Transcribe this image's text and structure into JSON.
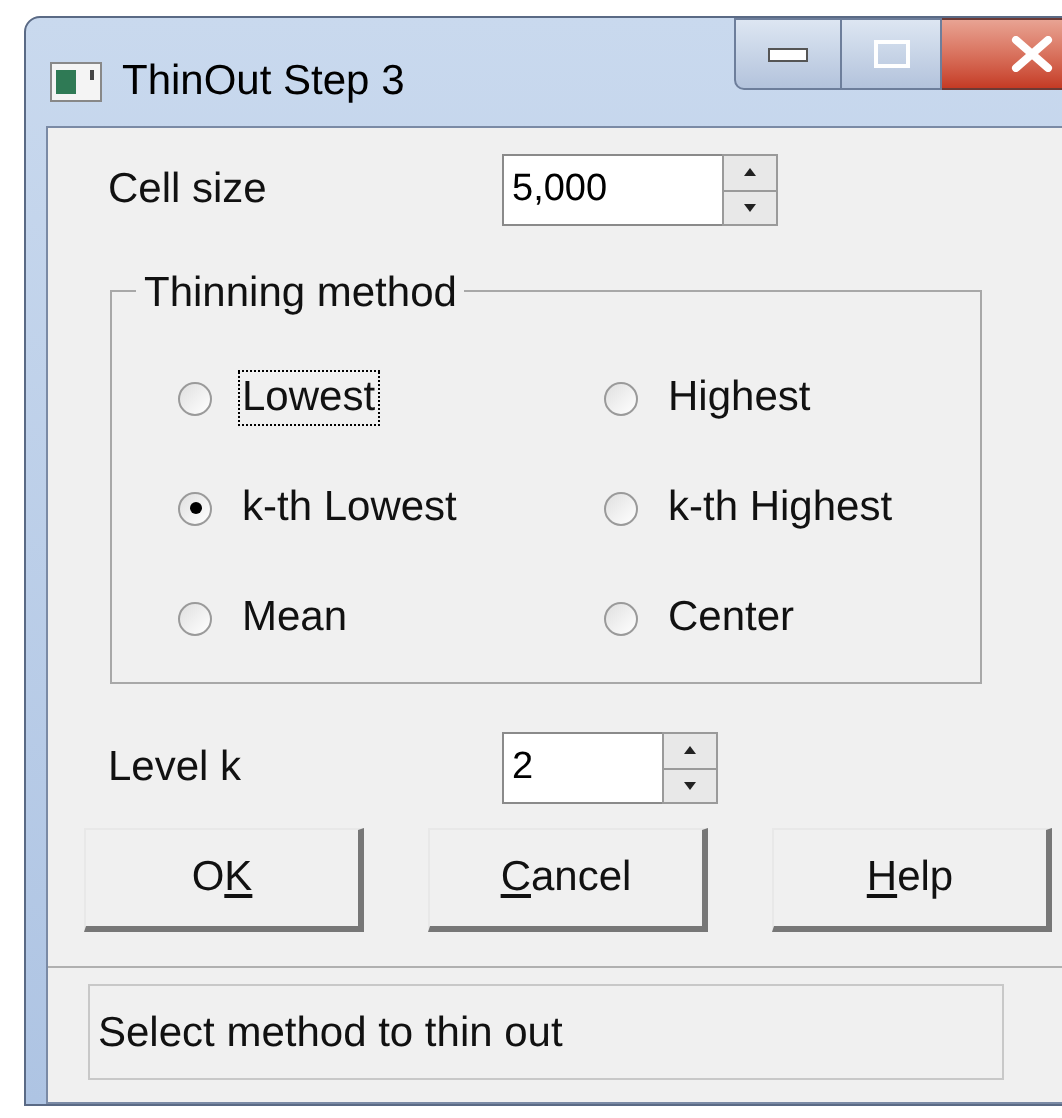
{
  "window": {
    "title": "ThinOut Step 3"
  },
  "cell_size": {
    "label": "Cell size",
    "value": "5,000"
  },
  "thinning_method": {
    "title": "Thinning method",
    "options": [
      {
        "label": "Lowest",
        "selected": false,
        "focused": true
      },
      {
        "label": "Highest",
        "selected": false,
        "focused": false
      },
      {
        "label": "k-th Lowest",
        "selected": true,
        "focused": false
      },
      {
        "label": "k-th Highest",
        "selected": false,
        "focused": false
      },
      {
        "label": "Mean",
        "selected": false,
        "focused": false
      },
      {
        "label": "Center",
        "selected": false,
        "focused": false
      }
    ]
  },
  "level_k": {
    "label": "Level k",
    "value": "2"
  },
  "buttons": [
    {
      "pre": "O",
      "key": "K"
    },
    {
      "key": "C",
      "post": "ancel"
    },
    {
      "key": "H",
      "post": "elp"
    }
  ],
  "status_bar": "Select method to thin out"
}
